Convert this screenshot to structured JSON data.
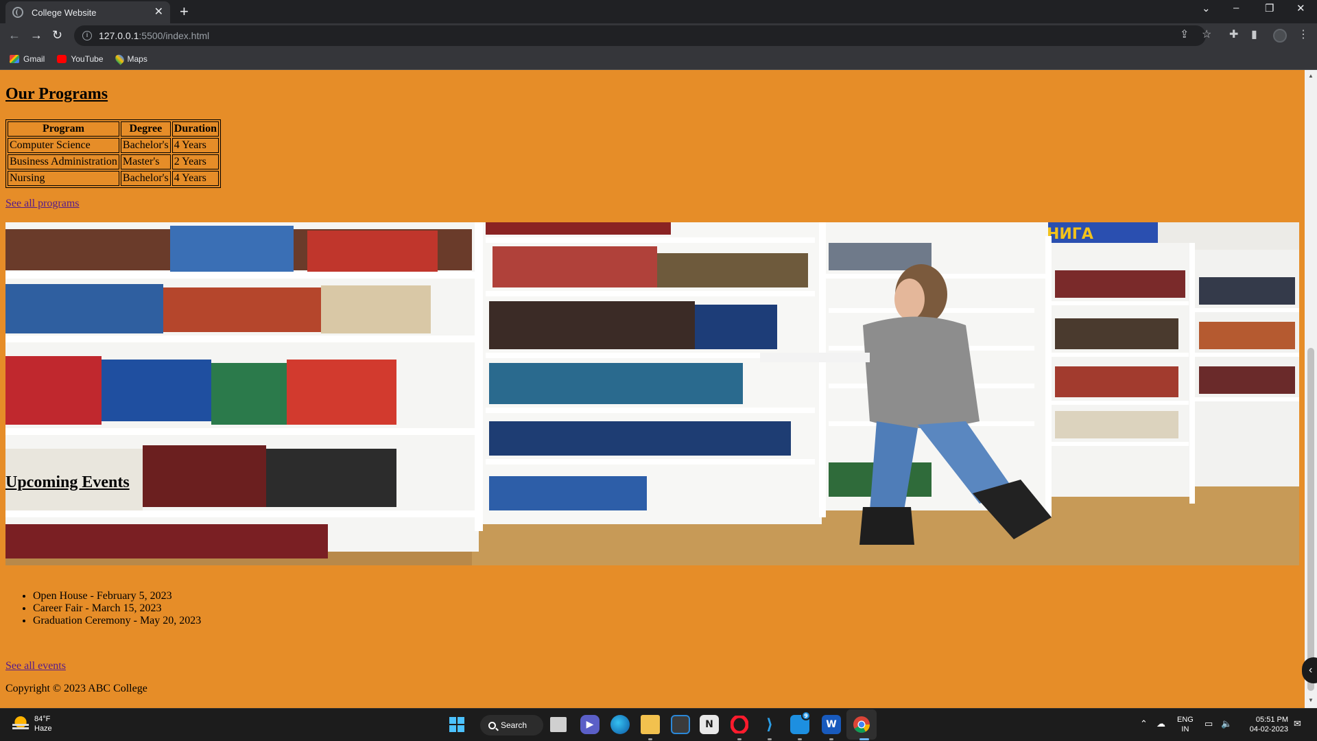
{
  "browser": {
    "tab_title": "College Website",
    "url_host": "127.0.0.1",
    "url_path": ":5500/index.html",
    "bookmarks": [
      "Gmail",
      "YouTube",
      "Maps"
    ]
  },
  "page": {
    "programs_heading": "Our Programs",
    "programs_table": {
      "headers": [
        "Program",
        "Degree",
        "Duration"
      ],
      "rows": [
        [
          "Computer Science",
          "Bachelor's",
          "4 Years"
        ],
        [
          "Business Administration",
          "Master's",
          "2 Years"
        ],
        [
          "Nursing",
          "Bachelor's",
          "4 Years"
        ]
      ]
    },
    "see_all_programs": "See all programs",
    "library_image_sign": "КНИГА",
    "events_heading": "Upcoming Events",
    "events": [
      "Open House - February 5, 2023",
      "Career Fair - March 15, 2023",
      "Graduation Ceremony - May 20, 2023"
    ],
    "see_all_events": "See all events",
    "copyright": "Copyright © 2023 ABC College",
    "background_color": "#e68d28",
    "link_color": "#551a8b"
  },
  "taskbar": {
    "weather_temp": "84°F",
    "weather_desc": "Haze",
    "search_label": "Search",
    "lang_top": "ENG",
    "lang_bottom": "IN",
    "time": "05:51 PM",
    "date": "04-02-2023",
    "notification_badge": "9"
  }
}
